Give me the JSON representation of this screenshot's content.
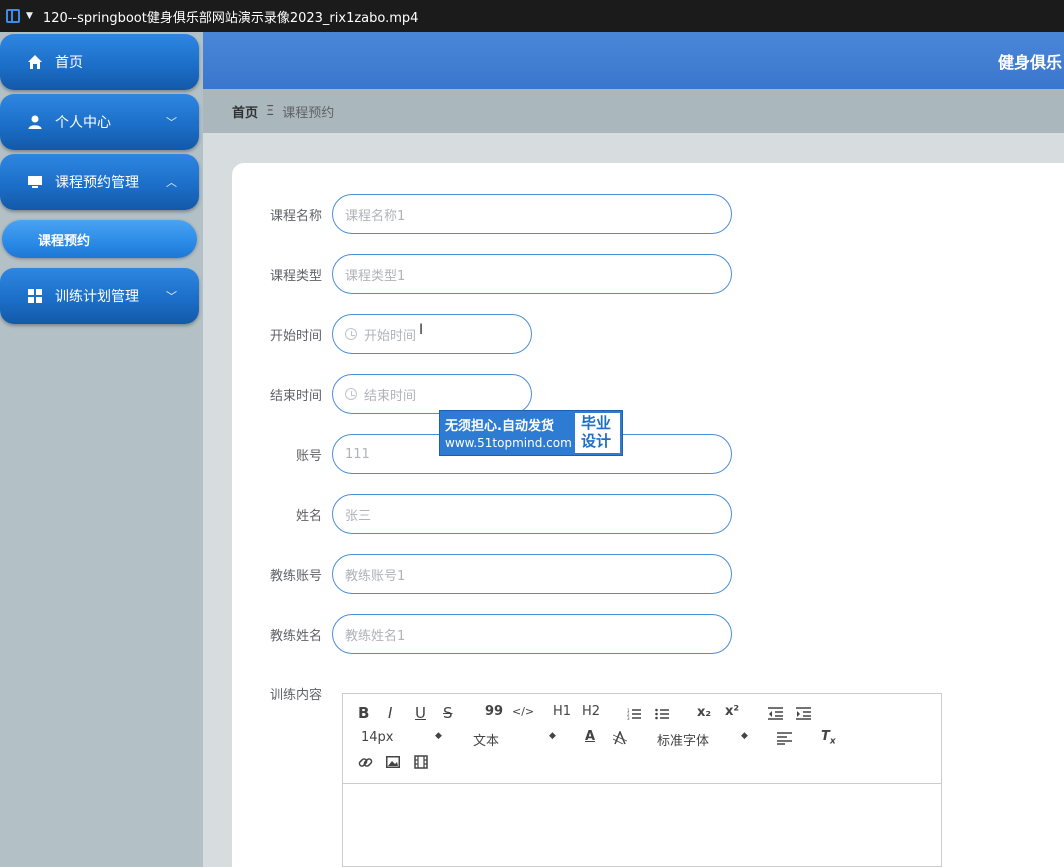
{
  "window": {
    "title": "120--springboot健身俱乐部网站演示录像2023_rix1zabo.mp4"
  },
  "header": {
    "site_title": "健身俱乐"
  },
  "sidebar": {
    "items": [
      {
        "label": "首页",
        "icon": "home-icon"
      },
      {
        "label": "个人中心",
        "icon": "user-icon"
      },
      {
        "label": "课程预约管理",
        "icon": "monitor-icon"
      },
      {
        "label": "训练计划管理",
        "icon": "grid-icon"
      }
    ],
    "sub_item": {
      "label": "课程预约"
    }
  },
  "breadcrumb": {
    "home": "首页",
    "separator": "Ξ",
    "current": "课程预约"
  },
  "form": {
    "fields": [
      {
        "label": "课程名称",
        "value": "课程名称1"
      },
      {
        "label": "课程类型",
        "value": "课程类型1"
      },
      {
        "label": "开始时间",
        "placeholder": "开始时间"
      },
      {
        "label": "结束时间",
        "placeholder": "结束时间"
      },
      {
        "label": "账号",
        "value": "111"
      },
      {
        "label": "姓名",
        "value": "张三"
      },
      {
        "label": "教练账号",
        "value": "教练账号1"
      },
      {
        "label": "教练姓名",
        "value": "教练姓名1"
      }
    ],
    "content_label": "训练内容"
  },
  "editor": {
    "font_size": "14px",
    "header_select": "文本",
    "font_family": "标准字体",
    "buttons": {
      "bold": "B",
      "italic": "I",
      "underline": "U",
      "strike": "S",
      "quote": "99",
      "code": "</>",
      "h1": "H1",
      "h2": "H2",
      "sub": "x₂",
      "sup": "x²"
    }
  },
  "watermark": {
    "line1": "无须担心.自动发货",
    "line2": "www.51topmind.com",
    "badge_line1": "毕业",
    "badge_line2": "设计"
  },
  "colors": {
    "primary": "#1c6fc9",
    "header": "#3a76cb",
    "input_border": "#4a8fd8"
  }
}
